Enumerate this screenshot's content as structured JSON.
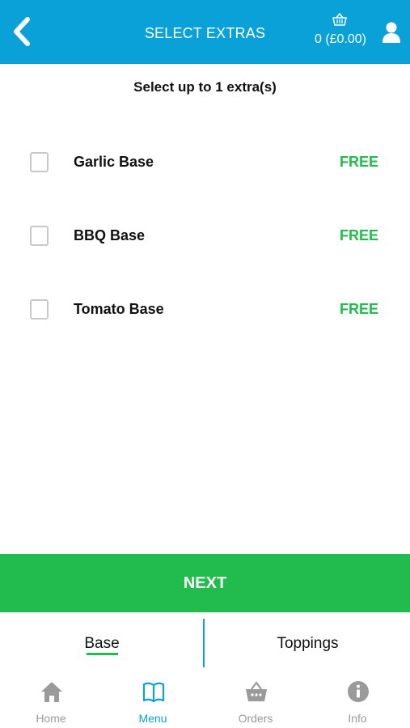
{
  "colors": {
    "header_bg": "#0aa0d8",
    "accent_green": "#22bb4e",
    "active_tab": "#0aa0d8",
    "inactive_tab": "#9a9a9a"
  },
  "header": {
    "title": "SELECT EXTRAS",
    "back_icon": "chevron-left-icon",
    "basket_icon": "basket-icon",
    "basket_text": "0 (£0.00)",
    "user_icon": "user-icon"
  },
  "subtitle": "Select up to 1 extra(s)",
  "options": [
    {
      "label": "Garlic Base",
      "price": "FREE",
      "checked": false
    },
    {
      "label": "BBQ Base",
      "price": "FREE",
      "checked": false
    },
    {
      "label": "Tomato Base",
      "price": "FREE",
      "checked": false
    }
  ],
  "next_button": "NEXT",
  "steps": [
    {
      "label": "Base",
      "active": true
    },
    {
      "label": "Toppings",
      "active": false
    }
  ],
  "tabs": [
    {
      "label": "Home",
      "icon": "home-icon",
      "active": false
    },
    {
      "label": "Menu",
      "icon": "book-icon",
      "active": true
    },
    {
      "label": "Orders",
      "icon": "basket-icon",
      "active": false
    },
    {
      "label": "Info",
      "icon": "info-icon",
      "active": false
    }
  ]
}
